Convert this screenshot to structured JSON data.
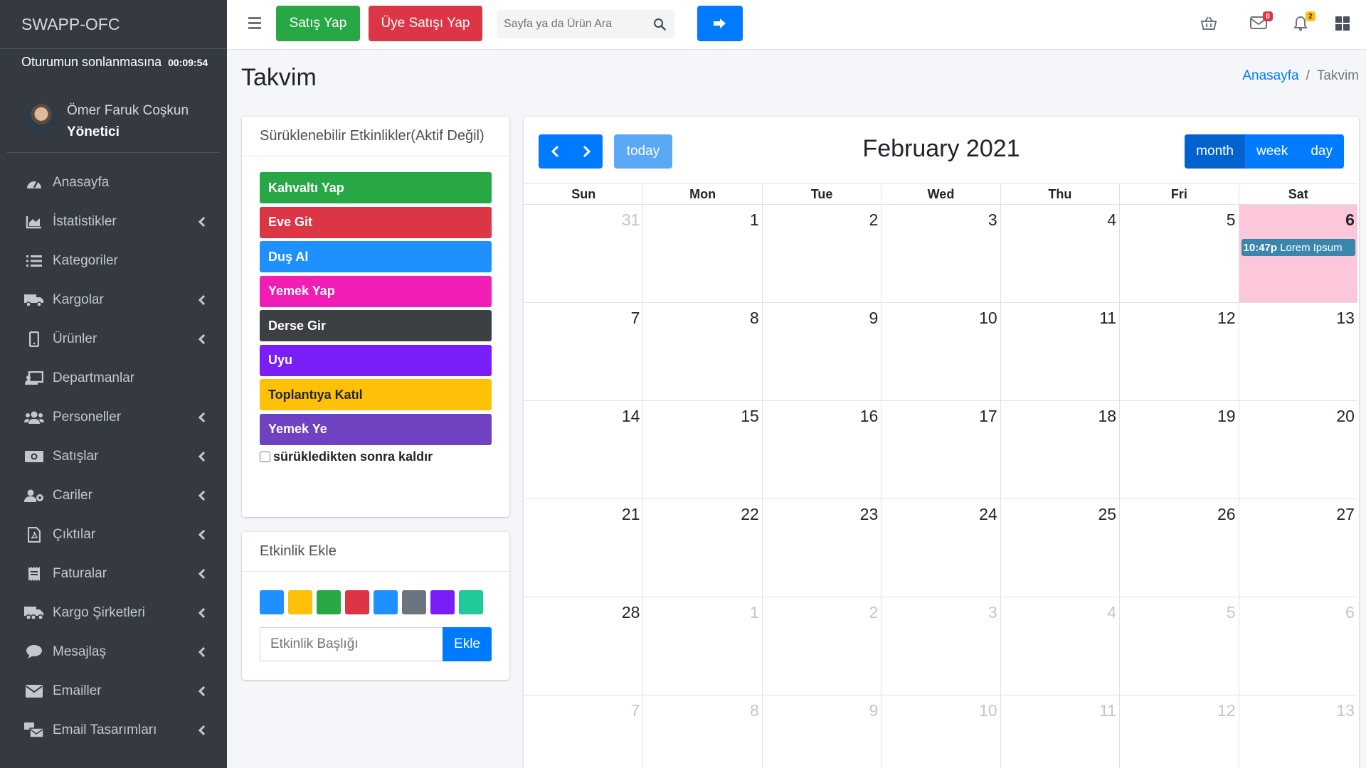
{
  "sidebar": {
    "brand": "SWAPP-OFC",
    "session_label": "Oturumun sonlanmasına",
    "session_time": "00:09:54",
    "user_name": "Ömer Faruk Coşkun",
    "user_role": "Yönetici",
    "items": [
      {
        "label": "Anasayfa",
        "icon": "dashboard-icon",
        "has_submenu": false
      },
      {
        "label": "İstatistikler",
        "icon": "chart-area-icon",
        "has_submenu": true
      },
      {
        "label": "Kategoriler",
        "icon": "list-icon",
        "has_submenu": false
      },
      {
        "label": "Kargolar",
        "icon": "truck-icon",
        "has_submenu": true
      },
      {
        "label": "Ürünler",
        "icon": "mobile-icon",
        "has_submenu": true
      },
      {
        "label": "Departmanlar",
        "icon": "chalkboard-icon",
        "has_submenu": false
      },
      {
        "label": "Personeller",
        "icon": "users-icon",
        "has_submenu": true
      },
      {
        "label": "Satışlar",
        "icon": "money-icon",
        "has_submenu": true
      },
      {
        "label": "Cariler",
        "icon": "users-cog-icon",
        "has_submenu": true
      },
      {
        "label": "Çıktılar",
        "icon": "file-pdf-icon",
        "has_submenu": true
      },
      {
        "label": "Faturalar",
        "icon": "receipt-icon",
        "has_submenu": true
      },
      {
        "label": "Kargo Şirketleri",
        "icon": "truck-moving-icon",
        "has_submenu": true
      },
      {
        "label": "Mesajlaş",
        "icon": "comment-icon",
        "has_submenu": true
      },
      {
        "label": "Emailler",
        "icon": "envelope-icon",
        "has_submenu": true
      },
      {
        "label": "Email Tasarımları",
        "icon": "mail-bulk-icon",
        "has_submenu": true
      }
    ]
  },
  "topbar": {
    "sell_label": "Satış Yap",
    "member_sell_label": "Üye Satışı Yap",
    "search_placeholder": "Sayfa ya da Ürün Ara",
    "mail_badge": "0",
    "bell_badge": "2"
  },
  "page": {
    "title": "Takvim",
    "breadcrumb_home": "Anasayfa",
    "breadcrumb_sep": "/",
    "breadcrumb_current": "Takvim"
  },
  "draggable": {
    "title": "Sürüklenebilir Etkinlikler(Aktif Değil)",
    "events": [
      {
        "label": "Kahvaltı Yap",
        "color": "#28a745"
      },
      {
        "label": "Eve Git",
        "color": "#dc3545"
      },
      {
        "label": "Duş Al",
        "color": "#1e90ff"
      },
      {
        "label": "Yemek Yap",
        "color": "#f01eb4"
      },
      {
        "label": "Derse Gir",
        "color": "#3d4043"
      },
      {
        "label": "Uyu",
        "color": "#7a1ef7"
      },
      {
        "label": "Toplantıya Katıl",
        "color": "#ffc107"
      },
      {
        "label": "Yemek Ye",
        "color": "#6f42c1"
      }
    ],
    "remove_label": "sürükledikten sonra kaldır"
  },
  "add_event": {
    "title": "Etkinlik Ekle",
    "swatches": [
      "#1e90ff",
      "#ffc107",
      "#28a745",
      "#dc3545",
      "#1e90ff",
      "#6c757d",
      "#7a1ef7",
      "#20c997"
    ],
    "input_placeholder": "Etkinlik Başlığı",
    "button_label": "Ekle"
  },
  "calendar": {
    "title": "February 2021",
    "today_label": "today",
    "views": [
      "month",
      "week",
      "day"
    ],
    "active_view": "month",
    "day_names": [
      "Sun",
      "Mon",
      "Tue",
      "Wed",
      "Thu",
      "Fri",
      "Sat"
    ],
    "weeks": [
      [
        {
          "d": "31",
          "o": true
        },
        {
          "d": "1"
        },
        {
          "d": "2"
        },
        {
          "d": "3"
        },
        {
          "d": "4"
        },
        {
          "d": "5"
        },
        {
          "d": "6",
          "today": true
        }
      ],
      [
        {
          "d": "7"
        },
        {
          "d": "8"
        },
        {
          "d": "9"
        },
        {
          "d": "10"
        },
        {
          "d": "11"
        },
        {
          "d": "12"
        },
        {
          "d": "13"
        }
      ],
      [
        {
          "d": "14"
        },
        {
          "d": "15"
        },
        {
          "d": "16"
        },
        {
          "d": "17"
        },
        {
          "d": "18"
        },
        {
          "d": "19"
        },
        {
          "d": "20"
        }
      ],
      [
        {
          "d": "21"
        },
        {
          "d": "22"
        },
        {
          "d": "23"
        },
        {
          "d": "24"
        },
        {
          "d": "25"
        },
        {
          "d": "26"
        },
        {
          "d": "27"
        }
      ],
      [
        {
          "d": "28"
        },
        {
          "d": "1",
          "o": true
        },
        {
          "d": "2",
          "o": true
        },
        {
          "d": "3",
          "o": true
        },
        {
          "d": "4",
          "o": true
        },
        {
          "d": "5",
          "o": true
        },
        {
          "d": "6",
          "o": true
        }
      ],
      [
        {
          "d": "7",
          "o": true
        },
        {
          "d": "8",
          "o": true
        },
        {
          "d": "9",
          "o": true
        },
        {
          "d": "10",
          "o": true
        },
        {
          "d": "11",
          "o": true
        },
        {
          "d": "12",
          "o": true
        },
        {
          "d": "13",
          "o": true
        }
      ]
    ],
    "event": {
      "time": "10:47p",
      "title": "Lorem Ipsum",
      "week": 0,
      "day": 6
    }
  }
}
